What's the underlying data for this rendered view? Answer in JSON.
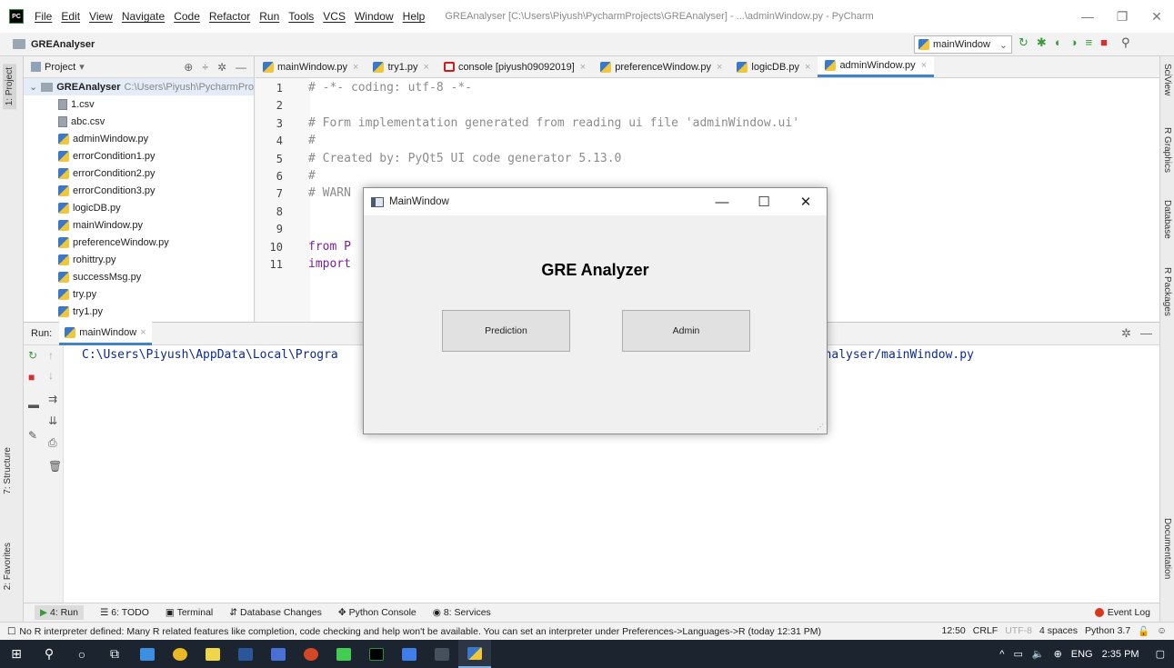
{
  "menu": {
    "items": [
      "File",
      "Edit",
      "View",
      "Navigate",
      "Code",
      "Refactor",
      "Run",
      "Tools",
      "VCS",
      "Window",
      "Help"
    ],
    "window_title": "GREAnalyser [C:\\Users\\Piyush\\PycharmProjects\\GREAnalyser] - ...\\adminWindow.py - PyCharm",
    "logo": "PC"
  },
  "navbar": {
    "project": "GREAnalyser",
    "run_config": "mainWindow"
  },
  "left_strip": {
    "project_tab": "1: Project",
    "structure_tab": "7: Structure",
    "favorites_tab": "2: Favorites"
  },
  "right_strip": {
    "sciview": "SciView",
    "rgraphics": "R Graphics",
    "database": "Database",
    "rpackages": "R Packages",
    "documentation": "Documentation"
  },
  "project_panel": {
    "header": "Project",
    "root_name": "GREAnalyser",
    "root_path": "C:\\Users\\Piyush\\PycharmPro",
    "files": [
      {
        "name": "1.csv",
        "type": "csv"
      },
      {
        "name": "abc.csv",
        "type": "csv"
      },
      {
        "name": "adminWindow.py",
        "type": "py"
      },
      {
        "name": "errorCondition1.py",
        "type": "py"
      },
      {
        "name": "errorCondition2.py",
        "type": "py"
      },
      {
        "name": "errorCondition3.py",
        "type": "py"
      },
      {
        "name": "logicDB.py",
        "type": "py"
      },
      {
        "name": "mainWindow.py",
        "type": "py"
      },
      {
        "name": "preferenceWindow.py",
        "type": "py"
      },
      {
        "name": "rohittry.py",
        "type": "py"
      },
      {
        "name": "successMsg.py",
        "type": "py"
      },
      {
        "name": "try.py",
        "type": "py"
      },
      {
        "name": "try1.py",
        "type": "py"
      }
    ]
  },
  "editor_tabs": [
    {
      "label": "mainWindow.py",
      "icon": "py"
    },
    {
      "label": "try1.py",
      "icon": "py"
    },
    {
      "label": "console [piyush09092019]",
      "icon": "console"
    },
    {
      "label": "preferenceWindow.py",
      "icon": "py"
    },
    {
      "label": "logicDB.py",
      "icon": "py"
    },
    {
      "label": "adminWindow.py",
      "icon": "py",
      "active": true
    }
  ],
  "editor": {
    "lines": [
      {
        "n": "1",
        "text": "# -*- coding: utf-8 -*-"
      },
      {
        "n": "2",
        "text": ""
      },
      {
        "n": "3",
        "text": "# Form implementation generated from reading ui file 'adminWindow.ui'"
      },
      {
        "n": "4",
        "text": "#"
      },
      {
        "n": "5",
        "text": "# Created by: PyQt5 UI code generator 5.13.0"
      },
      {
        "n": "6",
        "text": "#"
      },
      {
        "n": "7",
        "text": "# WARN"
      },
      {
        "n": "8",
        "text": ""
      },
      {
        "n": "9",
        "text": ""
      },
      {
        "n": "10",
        "text": "from P"
      },
      {
        "n": "11",
        "text": "import"
      }
    ]
  },
  "run_panel": {
    "label": "Run:",
    "tab": "mainWindow",
    "command_left": "C:\\Users\\Piyush\\AppData\\Local\\Progra",
    "command_right": "ts/GREAnalyser/mainWindow.py"
  },
  "bottom_tabs": {
    "run": "4: Run",
    "todo": "6: TODO",
    "terminal": "Terminal",
    "db_changes": "Database Changes",
    "python_console": "Python Console",
    "services": "8: Services",
    "event_log": "Event Log"
  },
  "status": {
    "message": "No R interpreter defined: Many R related features like completion, code checking and help won't be available. You can set an interpreter under Preferences->Languages->R (today 12:31 PM)",
    "position": "12:50",
    "line_sep": "CRLF",
    "encoding": "UTF-8",
    "indent": "4 spaces",
    "interpreter": "Python 3.7"
  },
  "taskbar": {
    "lang": "ENG",
    "time": "2:35 PM"
  },
  "dialog": {
    "title": "MainWindow",
    "heading": "GRE Analyzer",
    "prediction_button": "Prediction",
    "admin_button": "Admin"
  }
}
